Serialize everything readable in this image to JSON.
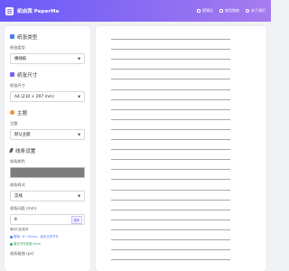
{
  "header": {
    "brand": "纸由我 PaperMe",
    "nav": [
      {
        "label": "提建议",
        "icon": "feedback-icon"
      },
      {
        "label": "使用指南",
        "icon": "guide-icon"
      },
      {
        "label": "关于我们",
        "icon": "info-icon"
      }
    ]
  },
  "sidebar": {
    "paper_type": {
      "title": "纸张类型",
      "label": "纸张类型",
      "value": "横线纸"
    },
    "paper_size": {
      "title": "纸张尺寸",
      "label": "纸张尺寸",
      "value": "A4 (210 × 297 mm)"
    },
    "theme": {
      "title": "主题",
      "label": "主题",
      "value": "默认主题"
    },
    "line_settings": {
      "title": "线条设置",
      "color_label": "线条颜色",
      "color_value": "#7d7d7d",
      "style_label": "线条样式",
      "style_value": "实线",
      "spacing_label": "线条间距 (mm)",
      "spacing_value": "8",
      "spacing_button": "推荐",
      "hint_range": "横线行距推荐",
      "hint_blue": "推荐：6~10mm，适合日常书写",
      "hint_green": "最佳书写距离 8mm",
      "width_label": "线条粗细 (px)"
    }
  },
  "colors": {
    "accent": "#6a5af9",
    "line": "#a7a7a7",
    "icon_type": "#4a7cf0",
    "icon_size": "#7b63f4",
    "icon_theme": "#f0903a",
    "icon_line": "#555555"
  },
  "preview": {
    "line_count": 23
  }
}
